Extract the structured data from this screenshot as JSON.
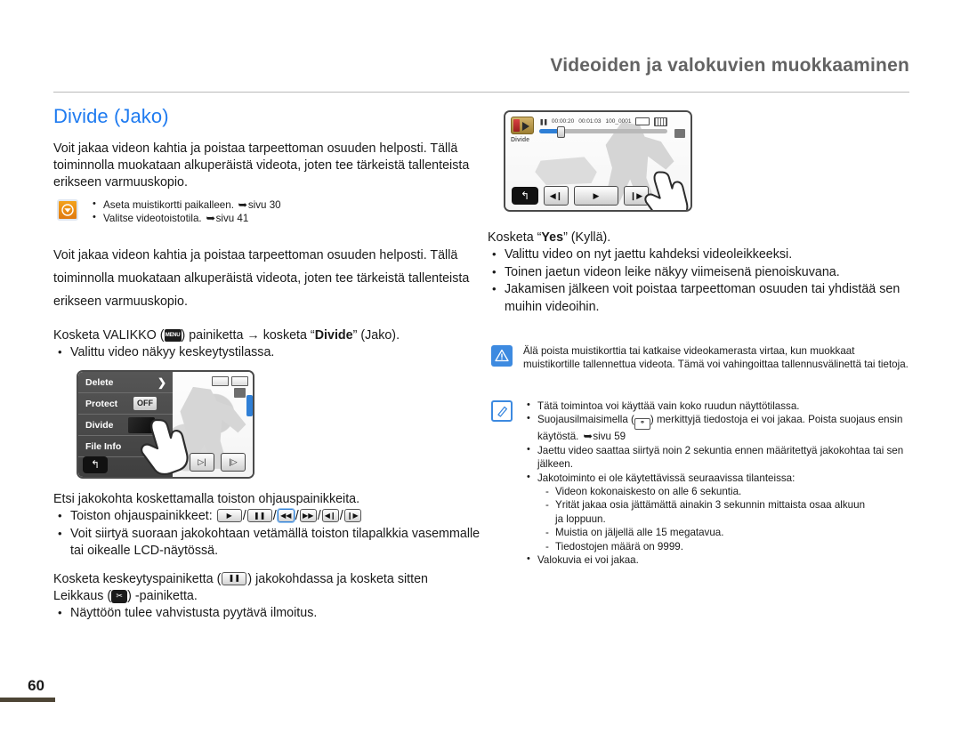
{
  "header": {
    "running_head": "Videoiden ja valokuvien muokkaaminen"
  },
  "page": {
    "title": "Divide (Jako)",
    "folio": "60"
  },
  "left": {
    "intro": "Voit jakaa videon kahtia ja poistaa tarpeettoman osuuden helposti. Tällä toiminnolla muokataan alkuperäistä videota, joten tee tärkeistä tallenteista erikseen varmuuskopio.",
    "precheck": {
      "icon": "check-circle-icon",
      "items": [
        "Aseta muistikortti paikalleen.",
        "Valitse videotoistotila."
      ],
      "refs": [
        "sivu 30",
        "sivu 41"
      ]
    },
    "step1": "Voit jakaa videon kahtia ja poistaa tarpeettoman osuuden helposti. Tällä toiminnolla muokataan alkuperäistä videota, joten tee tärkeistä tallenteista erikseen varmuuskopio.",
    "step2_a": "Kosketa VALIKKO (",
    "step2_b": ") painiketta ",
    "step2_arrow": "→",
    "step2_c": " kosketa “",
    "step2_bold": "Divide",
    "step2_d": "” (Jako).",
    "step2_note": "Valittu video näkyy keskeytystilassa.",
    "lcd_menu": {
      "rows": [
        {
          "label": "Delete",
          "control": "chevron"
        },
        {
          "label": "Protect",
          "control": "off",
          "value": "OFF"
        },
        {
          "label": "Divide",
          "control": "chevron-thumb"
        },
        {
          "label": "File Info",
          "control": "chevron"
        }
      ],
      "back_glyph": "↰",
      "chevron_glyph": "❯"
    },
    "step3": "Etsi jakokohta koskettamalla toiston ohjauspainikkeita.",
    "step3_controls_label": "Toiston ohjauspainikkeet:",
    "step3_controls": [
      "▶",
      "❚❚",
      "◀◀",
      "▶▶",
      "◀❙",
      "❙▶"
    ],
    "step3_note": "Voit siirtyä suoraan jakokohtaan vetämällä toiston tilapalkkia vasemmalle tai oikealle LCD-näytössä.",
    "step4_a": "Kosketa keskeytyspainiketta (",
    "step4_b": ") jakokohdassa ja kosketa sitten Leikkaus (",
    "step4_c": ") -painiketta.",
    "step4_note": "Näyttöön tulee vahvistusta pyytävä ilmoitus."
  },
  "right": {
    "lcd_play": {
      "status_pause": "❚❚",
      "time_current": "00:00:20",
      "time_total": "00:01:03",
      "file_name": "100_0001",
      "label_divide": "Divide",
      "back_glyph": "↰",
      "buttons": [
        "◀❙",
        "▶",
        "❙▶"
      ],
      "cut_glyph": "✂"
    },
    "step5_a": "Kosketa “",
    "step5_bold": "Yes",
    "step5_b": "” (Kyllä).",
    "step5_notes": [
      "Valittu video on nyt jaettu kahdeksi videoleikkeeksi.",
      "Toinen jaetun videon leike näkyy viimeisenä pienoiskuvana.",
      "Jakamisen jälkeen voit poistaa tarpeettoman osuuden tai yhdistää sen muihin videoihin."
    ],
    "warning": {
      "icon": "warning-triangle-icon",
      "text": "Älä poista muistikorttia tai katkaise videokamerasta virtaa, kun muokkaat muistikortille tallennettua videota. Tämä voi vahingoittaa tallennusvälinettä tai tietoja."
    },
    "note": {
      "icon": "note-pencil-icon",
      "items": [
        {
          "text": "Tätä toimintoa voi käyttää vain koko ruudun näyttötilassa."
        },
        {
          "text_a": "Suojausilmaisimella (",
          "text_b": ") merkittyjä tiedostoja ei voi jakaa. Poista suojaus ensin käytöstä.",
          "ref": "sivu 59"
        },
        {
          "text": "Jaettu video saattaa siirtyä noin 2 sekuntia ennen määritettyä jakokohtaa tai sen jälkeen."
        },
        {
          "text": "Jakotoiminto ei ole käytettävissä seuraavissa tilanteissa:",
          "sub": [
            "Videon kokonaiskesto on alle 6 sekuntia.",
            "Yrität jakaa osia jättämättä ainakin 3 sekunnin mittaista osaa alkuun",
            "ja loppuun.",
            "Muistia on jäljellä alle 15 megatavua.",
            "Tiedostojen määrä on 9999."
          ]
        },
        {
          "text": "Valokuvia ei voi jakaa."
        }
      ]
    }
  },
  "colors": {
    "title_blue": "#1f7bf0",
    "running_head": "#636363",
    "accent_blue": "#3d8ae0",
    "folio_bar": "#4d4535"
  }
}
